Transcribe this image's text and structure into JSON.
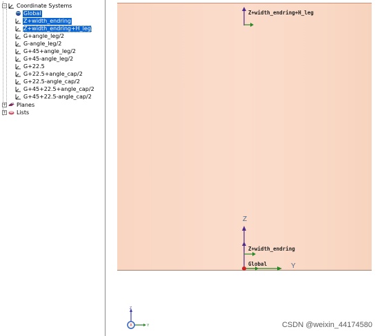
{
  "tree": {
    "items": [
      {
        "label": "Coordinate Systems",
        "expander": "−"
      },
      {
        "label": "Global"
      },
      {
        "label": "Z+width_endring"
      },
      {
        "label": "Z+width_endring+H_leg"
      },
      {
        "label": "G+angle_leg/2"
      },
      {
        "label": "G-angle_leg/2"
      },
      {
        "label": "G+45+angle_leg/2"
      },
      {
        "label": "G+45-angle_leg/2"
      },
      {
        "label": "G+22.5"
      },
      {
        "label": "G+22.5+angle_cap/2"
      },
      {
        "label": "G+22.5-angle_cap/2"
      },
      {
        "label": "G+45+22.5+angle_cap/2"
      },
      {
        "label": "G+45+22.5-angle_cap/2"
      },
      {
        "label": "Planes",
        "expander": "+"
      },
      {
        "label": "Lists",
        "expander": "+"
      }
    ]
  },
  "viewport": {
    "labels": {
      "top_cs": "Z+width_endring+H_leg",
      "mid_cs": "Z+width_endring",
      "global_cs": "Global",
      "axis_z": "Z",
      "axis_y": "Y"
    },
    "triad": {
      "z": "Z",
      "x": "X",
      "y": "Y"
    },
    "colors": {
      "solid": "#f9d8c6",
      "selection": "#0a64d2",
      "z_axis": "#4b2a8c",
      "y_axis": "#2a8a2a",
      "x_axis": "#d02020"
    }
  },
  "watermark": "CSDN @weixin_44174580"
}
